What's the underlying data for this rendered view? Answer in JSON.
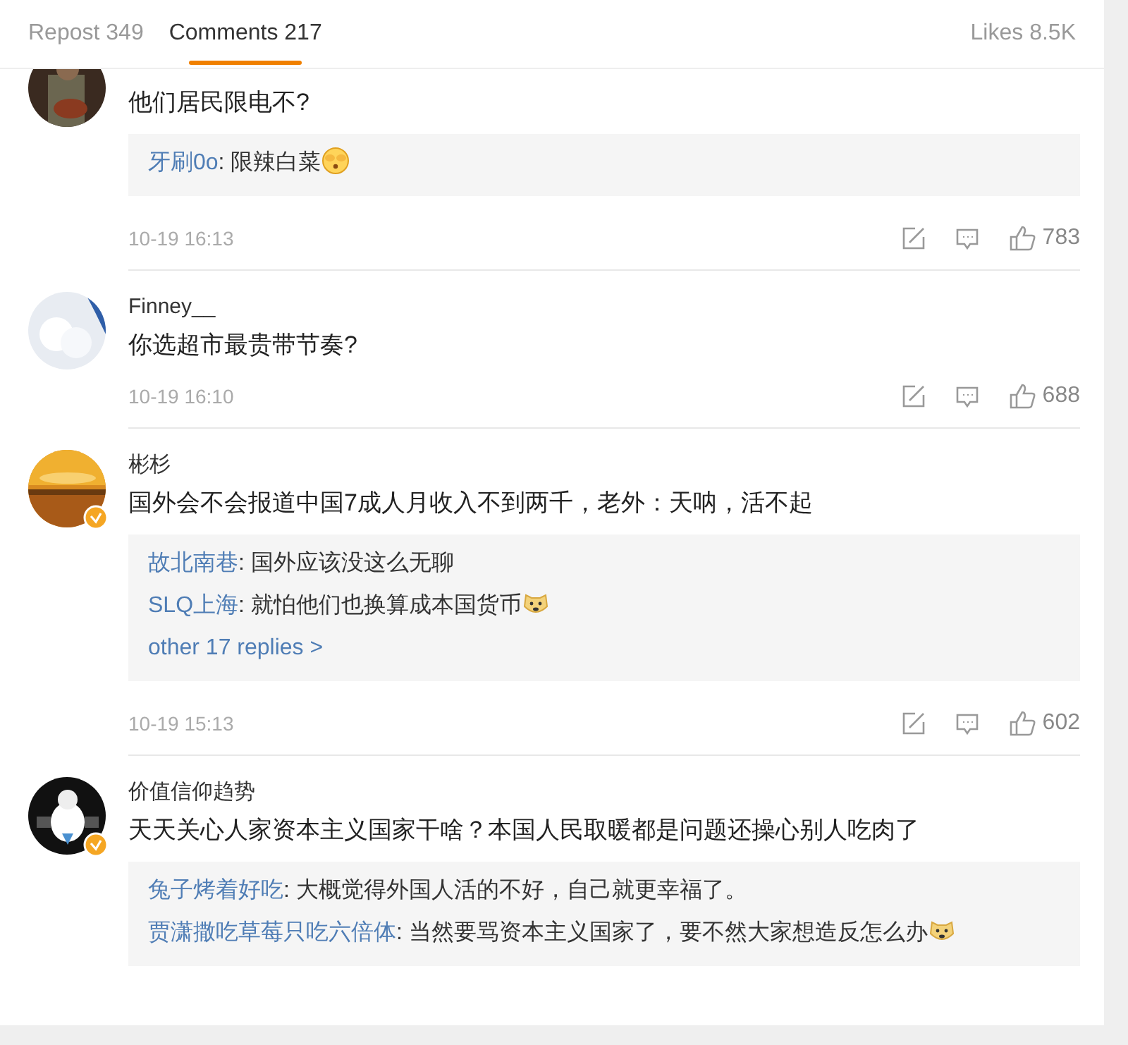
{
  "tabs": [
    {
      "label": "Repost 349",
      "selected": false
    },
    {
      "label": "Comments 217",
      "selected": true
    }
  ],
  "likes_total": "Likes 8.5K",
  "comments": [
    {
      "verified": false,
      "text": "他们居民限电不?",
      "replies": [
        {
          "user": "牙刷0o",
          "text": ": 限辣白菜",
          "emoji": true
        }
      ],
      "time": "10-19 16:13",
      "likes": "783"
    },
    {
      "name": "Finney__",
      "verified": false,
      "text": "你选超市最贵带节奏?",
      "time": "10-19 16:10",
      "likes": "688"
    },
    {
      "name": "彬杉",
      "verified": true,
      "text": "国外会不会报道中国7成人月收入不到两千，老外：天呐，活不起",
      "replies": [
        {
          "user": "故北南巷",
          "text": ": 国外应该没这么无聊",
          "emoji": false
        },
        {
          "user": "SLQ上海",
          "text": ": 就怕他们也换算成本国货币",
          "emoji": true
        }
      ],
      "more": "other 17 replies >",
      "time": "10-19 15:13",
      "likes": "602"
    },
    {
      "name": "价值信仰趋势",
      "verified": true,
      "text": "天天关心人家资本主义国家干啥？本国人民取暖都是问题还操心别人吃肉了",
      "replies": [
        {
          "user": "兔子烤着好吃",
          "text": ": 大概觉得外国人活的不好，自己就更幸福了。",
          "emoji": false
        },
        {
          "user": "贾潇撒吃草莓只吃六倍体",
          "text": ": 当然要骂资本主义国家了，要不然大家想造反怎么办",
          "emoji": true
        }
      ]
    }
  ]
}
